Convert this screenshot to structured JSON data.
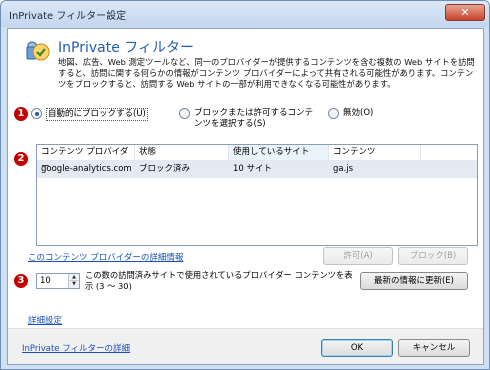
{
  "window": {
    "title": "InPrivate フィルター設定",
    "close_label": "✕"
  },
  "header": {
    "title": "InPrivate フィルター",
    "description": "地図、広告、Web 測定ツールなど、同一のプロバイダーが提供するコンテンツを含む複数の Web サイトを訪問すると、訪問に関する何らかの情報がコンテンツ プロバイダーによって共有される可能性があります。コンテンツをブロックすると、訪問する Web サイトの一部が利用できなくなる可能性があります。"
  },
  "badges": [
    "1",
    "2",
    "3"
  ],
  "mode_options": [
    {
      "label": "自動的にブロックする(U)",
      "selected": true
    },
    {
      "label": "ブロックまたは許可するコンテンツを選択する(S)",
      "selected": false
    },
    {
      "label": "無効(O)",
      "selected": false
    }
  ],
  "table": {
    "columns": [
      "コンテンツ プロバイダー",
      "状態",
      "使用しているサイト",
      "コンテンツ"
    ],
    "rows": [
      {
        "provider": "google-analytics.com",
        "status": "ブロック済み",
        "sites": "10 サイト",
        "content": "ga.js"
      }
    ]
  },
  "actions": {
    "details_link": "このコンテンツ プロバイダーの詳細情報",
    "allow_label": "許可(A)",
    "block_label": "ブロック(B)"
  },
  "threshold": {
    "value": "10",
    "label": "この数の訪問済みサイトで使用されているプロバイダー コンテンツを表示 (3 ～ 30)",
    "refresh_label": "最新の情報に更新(E)"
  },
  "advanced_link": "詳細設定",
  "footer": {
    "learn_link": "InPrivate フィルターの詳細",
    "ok_label": "OK",
    "cancel_label": "キャンセル"
  },
  "colors": {
    "badge": "#c40000",
    "link": "#1a4fb5",
    "title": "#1f5db0"
  }
}
